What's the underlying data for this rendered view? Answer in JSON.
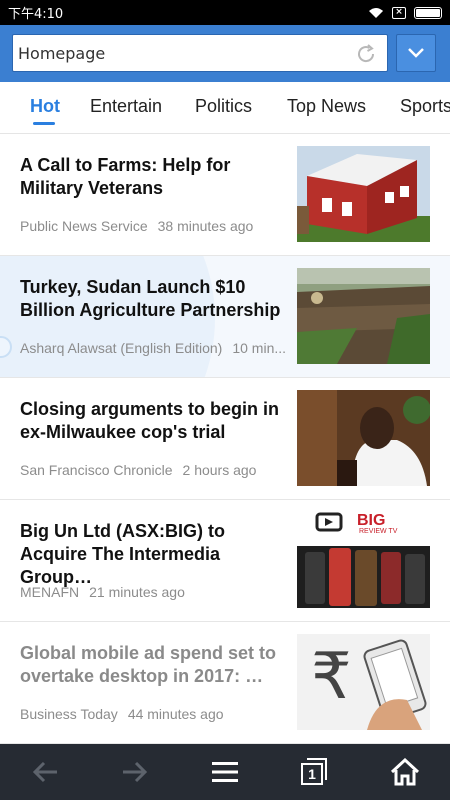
{
  "status_bar": {
    "time": "下午4:10",
    "sim_label": "×",
    "battery_level": 1.0
  },
  "toolbar": {
    "address_value": "Homepage"
  },
  "tabs": [
    {
      "label": "Hot",
      "active": true
    },
    {
      "label": "Entertain",
      "active": false
    },
    {
      "label": "Politics",
      "active": false
    },
    {
      "label": "Top News",
      "active": false
    },
    {
      "label": "Sports",
      "active": false
    }
  ],
  "articles": [
    {
      "headline": "A Call to Farms: Help for Military Veterans",
      "source": "Public News Service",
      "time": "38 minutes ago"
    },
    {
      "headline": "Turkey, Sudan Launch $10 Billion Agriculture Partnership",
      "source": "Asharq Alawsat (English Edition)",
      "time": "10 min..."
    },
    {
      "headline": "Closing arguments to begin in ex-Milwaukee cop's trial",
      "source": "San Francisco Chronicle",
      "time": "2 hours ago"
    },
    {
      "headline": "Big Un Ltd (ASX:BIG) to Acquire The Intermedia Group…",
      "source": "MENAFN",
      "time": "21 minutes ago",
      "thumb_text": "BIG",
      "thumb_subtext": "REVIEW TV"
    },
    {
      "headline": "Global mobile ad spend set to overtake desktop in 2017: …",
      "source": "Business Today",
      "time": "44 minutes ago",
      "read": true,
      "thumb_text": "₹"
    }
  ],
  "bottom_nav": {
    "tab_count": "1",
    "icons": [
      "back-arrow-icon",
      "forward-arrow-icon",
      "menu-icon",
      "tabs-icon",
      "home-icon"
    ]
  },
  "colors": {
    "accent": "#2a7fe0",
    "toolbar": "#3b7fd1",
    "nav_bar": "#262b33"
  }
}
